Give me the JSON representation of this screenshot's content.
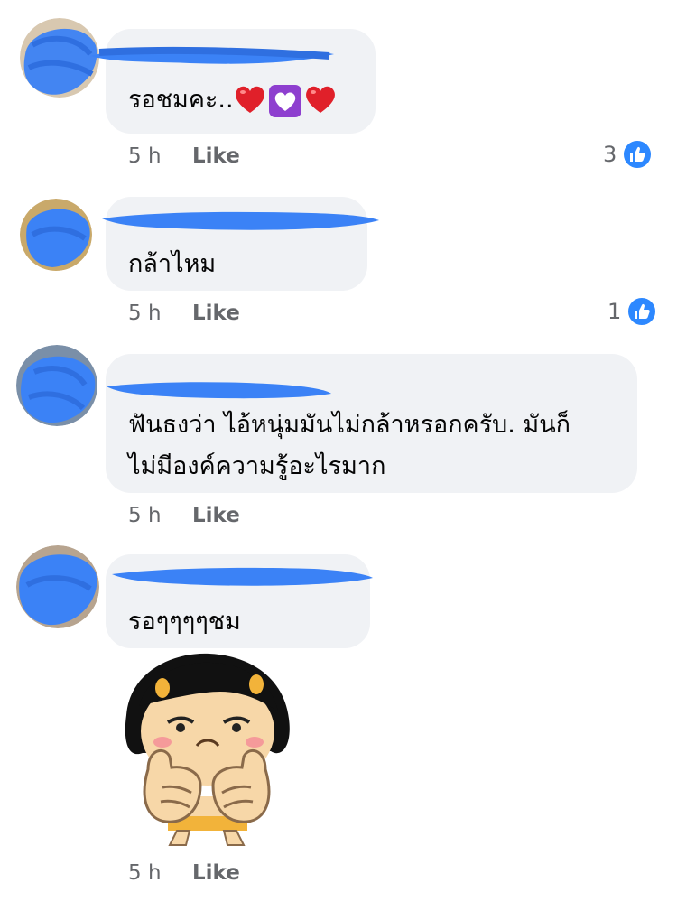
{
  "colors": {
    "bubble": "#f0f2f5",
    "meta_text": "#65676b",
    "like_blue": "#2d88ff",
    "scribble_blue": "#3b82f6"
  },
  "comments": [
    {
      "text": "รอชมคะ..",
      "emoji_icons": [
        "red-heart-icon",
        "heart-decoration-icon",
        "red-heart-icon"
      ],
      "time": "5 h",
      "like_label": "Like",
      "reaction_count": "3"
    },
    {
      "text": "กล้าไหม",
      "time": "5 h",
      "like_label": "Like",
      "reaction_count": "1"
    },
    {
      "text_lines": [
        "ฟันธงว่า ไอ้หนุ่มมันไม่กล้าหรอกครับ. มันก็",
        "ไม่มีองค์ความรู้อะไรมาก"
      ],
      "time": "5 h",
      "like_label": "Like"
    },
    {
      "text": "รอๆๆๆๆชม",
      "sticker_icon": "thumbs-up-girl-sticker",
      "time": "5 h",
      "like_label": "Like"
    }
  ]
}
